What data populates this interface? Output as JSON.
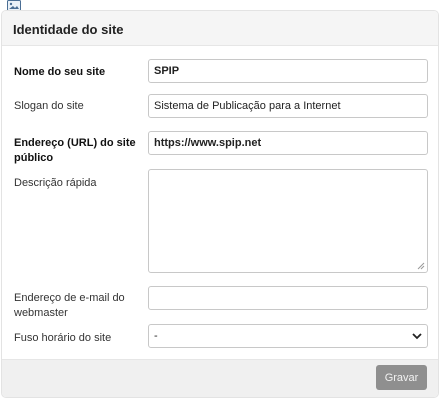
{
  "panel": {
    "title": "Identidade do site"
  },
  "form": {
    "site_name": {
      "label": "Nome do seu site",
      "value": "SPIP"
    },
    "slogan": {
      "label": "Slogan do site",
      "value": "Sistema de Publicação para a Internet"
    },
    "url": {
      "label": "Endereço (URL) do site público",
      "value": "https://www.spip.net"
    },
    "description": {
      "label": "Descrição rápida",
      "value": ""
    },
    "email": {
      "label": "Endereço de e-mail do webmaster",
      "value": ""
    },
    "timezone": {
      "label": "Fuso horário do site",
      "value": "-"
    }
  },
  "footer": {
    "save_label": "Gravar"
  },
  "icons": {
    "top": "picture-icon",
    "select": "chevron-down-icon",
    "resize": "resize-grip-icon"
  }
}
